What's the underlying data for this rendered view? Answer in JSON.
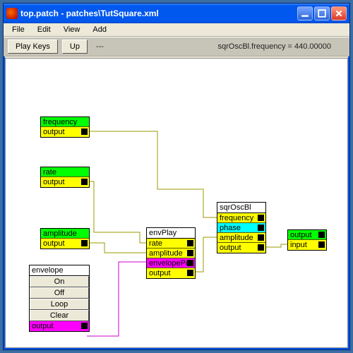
{
  "window": {
    "title": "top.patch - patches\\TutSquare.xml"
  },
  "menu": {
    "file": "File",
    "edit": "Edit",
    "view": "View",
    "add": "Add"
  },
  "toolbar": {
    "play_keys": "Play Keys",
    "up": "Up",
    "dash": "---",
    "readout": "sqrOscBl.frequency = 440.00000"
  },
  "nodes": {
    "frequency": {
      "title": "frequency",
      "output": "output"
    },
    "rate": {
      "title": "rate",
      "output": "output"
    },
    "amplitude": {
      "title": "amplitude",
      "output": "output"
    },
    "envelope": {
      "title": "envelope",
      "on": "On",
      "off": "Off",
      "loop": "Loop",
      "clear": "Clear",
      "output": "output"
    },
    "envPlay": {
      "title": "envPlay",
      "rate": "rate",
      "amplitude": "amplitude",
      "envelopePo": "envelopePo",
      "output": "output"
    },
    "sqrOscBl": {
      "title": "sqrOscBl",
      "frequency": "frequency",
      "phase": "phase",
      "amplitude": "amplitude",
      "output": "output"
    },
    "outnode": {
      "output": "output",
      "input": "input"
    }
  }
}
